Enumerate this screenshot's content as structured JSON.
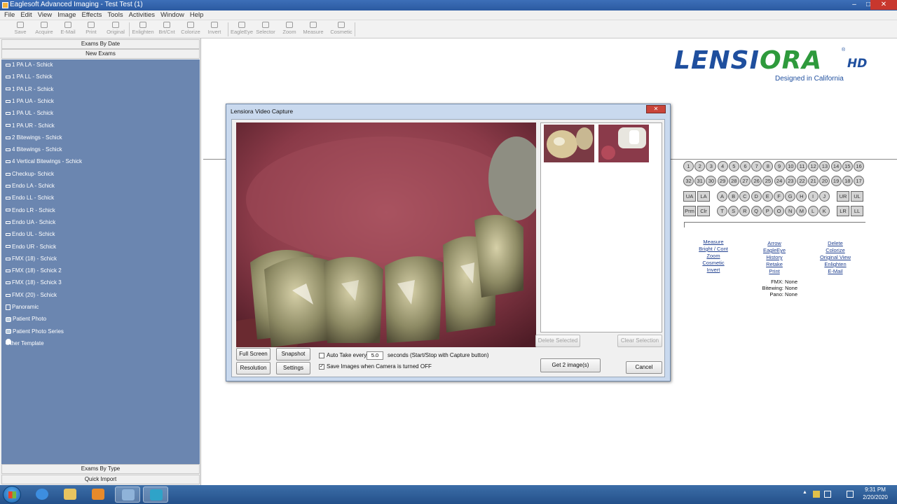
{
  "window": {
    "title": "Eaglesoft Advanced Imaging - Test Test (1)",
    "controls": [
      "–",
      "□",
      "✕"
    ]
  },
  "menu": [
    "File",
    "Edit",
    "View",
    "Image",
    "Effects",
    "Tools",
    "Activities",
    "Window",
    "Help"
  ],
  "toolbar": [
    {
      "label": "Save",
      "icon": "save-icon"
    },
    {
      "label": "Acquire",
      "icon": "acquire-icon"
    },
    {
      "label": "E-Mail",
      "icon": "email-icon"
    },
    {
      "label": "Print",
      "icon": "print-icon"
    },
    {
      "label": "Original",
      "icon": "original-icon"
    },
    {
      "label": "Enlighten",
      "icon": "enlighten-icon"
    },
    {
      "label": "Brt/Cnt",
      "icon": "brightness-icon"
    },
    {
      "label": "Colorize",
      "icon": "colorize-icon"
    },
    {
      "label": "Invert",
      "icon": "invert-icon"
    },
    {
      "label": "EagleEye",
      "icon": "eagleeye-icon"
    },
    {
      "label": "Selector",
      "icon": "selector-icon"
    },
    {
      "label": "Zoom",
      "icon": "zoom-icon"
    },
    {
      "label": "Measure",
      "icon": "measure-icon"
    },
    {
      "label": "Cosmetic",
      "icon": "cosmetic-icon"
    }
  ],
  "left_panel": {
    "header_top": "Exams By Date",
    "header_new": "New Exams",
    "exams": [
      "1 PA LA - Schick",
      "1 PA LL - Schick",
      "1 PA LR - Schick",
      "1 PA UA - Schick",
      "1 PA UL - Schick",
      "1 PA UR - Schick",
      "2 Bitewings - Schick",
      "4 Bitewings - Schick",
      "4 Vertical Bitewings - Schick",
      "Checkup- Schick",
      "Endo LA - Schick",
      "Endo LL - Schick",
      "Endo LR - Schick",
      "Endo UA - Schick",
      "Endo UL - Schick",
      "Endo UR - Schick",
      "FMX (18) - Schick",
      "FMX (18) - Schick 2",
      "FMX (18) - Schick 3",
      "FMX (20) - Schick",
      "Panoramic",
      "Patient Photo",
      "Patient Photo Series",
      "Other Template"
    ],
    "footer_type": "Exams By Type",
    "footer_import": "Quick Import"
  },
  "logo": {
    "word_blue": "LENSI",
    "word_green": "ORA",
    "hd": "HD",
    "reg": "®",
    "tagline": "Designed in California"
  },
  "tooth_chart": {
    "row1": [
      "1",
      "2",
      "3",
      "4",
      "5",
      "6",
      "7",
      "8",
      "9",
      "10",
      "11",
      "12",
      "13",
      "14",
      "15",
      "16"
    ],
    "row2": [
      "32",
      "31",
      "30",
      "29",
      "28",
      "27",
      "26",
      "25",
      "24",
      "23",
      "22",
      "21",
      "20",
      "19",
      "18",
      "17"
    ],
    "row3_left": [
      "UA",
      "LA"
    ],
    "row3_mid": [
      "A",
      "B",
      "C",
      "D",
      "E",
      "F",
      "G",
      "H",
      "I",
      "J"
    ],
    "row3_right": [
      "UR",
      "UL"
    ],
    "row4_left": [
      "Prm",
      "Clr"
    ],
    "row4_mid": [
      "T",
      "S",
      "R",
      "Q",
      "P",
      "O",
      "N",
      "M",
      "L",
      "K"
    ],
    "row4_right": [
      "LR",
      "LL"
    ]
  },
  "links": {
    "col1": [
      "Measure",
      "Bright / Cont",
      "Zoom",
      "Cosmetic",
      "Invert"
    ],
    "col2": [
      "Arrow",
      "EagleEye",
      "History",
      "Retake",
      "Print"
    ],
    "col3": [
      "Delete",
      "Colorize",
      "Original View",
      "Enlighten",
      "E-Mail"
    ]
  },
  "status": {
    "fmx": "FMX: None",
    "bitewing": "Bitewing: None",
    "pano": "Pano: None"
  },
  "dialog": {
    "title": "Lensiora Video Capture",
    "close": "✕",
    "buttons": {
      "full_screen": "Full Screen",
      "snapshot": "Snapshot",
      "resolution": "Resolution",
      "settings": "Settings",
      "delete_selected": "Delete Selected",
      "clear_selection": "Clear Selection",
      "get_images": "Get 2 image(s)",
      "cancel": "Cancel"
    },
    "auto_take_label": "Auto Take every",
    "auto_take_value": "5.0",
    "auto_take_suffix": "seconds (Start/Stop with Capture button)",
    "auto_take_checked": false,
    "save_images_label": "Save Images when Camera is turned OFF",
    "save_images_checked": true,
    "check_mark": "✓"
  },
  "taskbar": {
    "time": "9:31 PM",
    "date": "2/20/2020",
    "tray_arrow": "▲"
  },
  "colors": {
    "exam_list_bg": "#6b86b0",
    "dialog_frame": "#c9d9ee",
    "logo_blue": "#1f4f9e",
    "logo_green": "#2e9a3c",
    "taskbar": "#2a5a95"
  }
}
